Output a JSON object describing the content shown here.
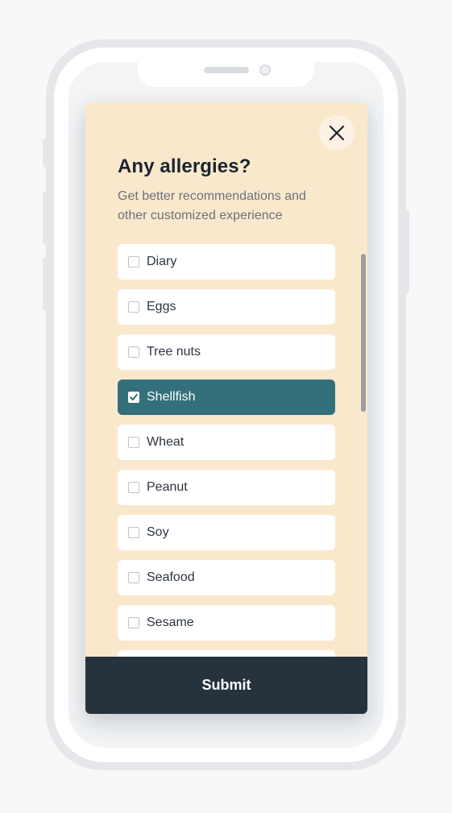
{
  "modal": {
    "title": "Any allergies?",
    "subtitle": "Get better recommendations and other customized experience",
    "close_icon": "close-icon",
    "submit_label": "Submit"
  },
  "allergies": [
    {
      "label": "Diary",
      "checked": false
    },
    {
      "label": "Eggs",
      "checked": false
    },
    {
      "label": "Tree nuts",
      "checked": false
    },
    {
      "label": "Shellfish",
      "checked": true
    },
    {
      "label": "Wheat",
      "checked": false
    },
    {
      "label": "Peanut",
      "checked": false
    },
    {
      "label": "Soy",
      "checked": false
    },
    {
      "label": "Seafood",
      "checked": false
    },
    {
      "label": "Sesame",
      "checked": false
    },
    {
      "label": "",
      "checked": false
    }
  ],
  "colors": {
    "modal_background": "#fae8cd",
    "selected_item": "#33707a",
    "submit_background": "#26323c",
    "title_text": "#1b2430"
  }
}
